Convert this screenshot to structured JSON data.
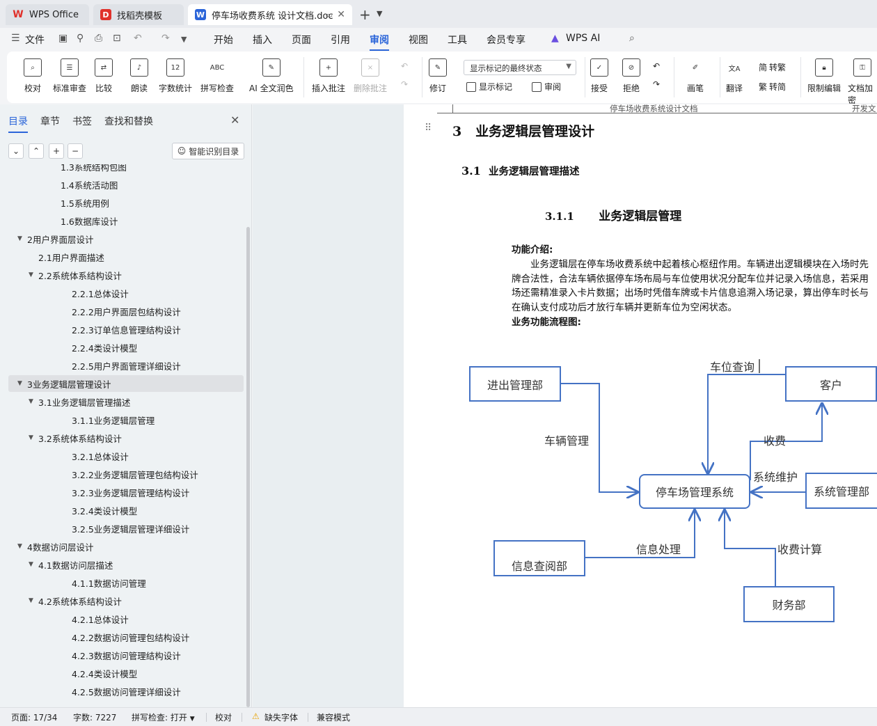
{
  "titlebar": {
    "tabs": [
      {
        "label": "WPS Office",
        "icon": "wps-logo-icon"
      },
      {
        "label": "找稻壳模板",
        "icon": "docer-icon"
      },
      {
        "label": "停车场收费系统 设计文档.doc",
        "icon": "word-doc-icon",
        "active": true
      }
    ],
    "add_tab": "+",
    "more": "⌄"
  },
  "menubar": {
    "file": "文件",
    "items": [
      "开始",
      "插入",
      "页面",
      "引用",
      "审阅",
      "视图",
      "工具",
      "会员专享",
      "WPS AI"
    ],
    "active": "审阅"
  },
  "ribbon": {
    "proofread": "校对",
    "standard_review": "标准审查",
    "compare": "比较",
    "read_aloud": "朗读",
    "word_count": "字数统计",
    "word_count_icon_text": "12",
    "spell_check": "拼写检查",
    "spell_icon_text": "ABC",
    "ai_polish": "AI 全文润色",
    "insert_comment": "插入批注",
    "delete_comment": "删除批注",
    "markup_select": "显示标记的最终状态",
    "track_changes": "修订",
    "show_markup": "显示标记",
    "review": "审阅",
    "accept": "接受",
    "reject": "拒绝",
    "pen": "画笔",
    "translate": "翻译",
    "to_traditional": "转繁",
    "to_simplified": "转简",
    "restrict_edit": "限制编辑",
    "doc_encrypt": "文档加密"
  },
  "navpane": {
    "tabs": [
      "目录",
      "章节",
      "书签",
      "查找和替换"
    ],
    "active_tab": "目录",
    "smart_toc": "智能识别目录",
    "toc": [
      {
        "label": "1.3系统结构包图",
        "level": 2,
        "arrow": ""
      },
      {
        "label": "1.4系统活动图",
        "level": 2,
        "arrow": ""
      },
      {
        "label": "1.5系统用例",
        "level": 2,
        "arrow": ""
      },
      {
        "label": "1.6数据库设计",
        "level": 2,
        "arrow": ""
      },
      {
        "label": "2用户界面层设计",
        "level": 0,
        "arrow": "▼"
      },
      {
        "label": "2.1用户界面描述",
        "level": 1,
        "arrow": ""
      },
      {
        "label": "2.2系统体系结构设计",
        "level": 1,
        "arrow": "▼"
      },
      {
        "label": "2.2.1总体设计",
        "level": 3,
        "arrow": ""
      },
      {
        "label": "2.2.2用户界面层包结构设计",
        "level": 3,
        "arrow": ""
      },
      {
        "label": "2.2.3订单信息管理结构设计",
        "level": 3,
        "arrow": ""
      },
      {
        "label": "2.2.4类设计模型",
        "level": 3,
        "arrow": ""
      },
      {
        "label": "2.2.5用户界面管理详细设计",
        "level": 3,
        "arrow": ""
      },
      {
        "label": "3业务逻辑层管理设计",
        "level": 0,
        "arrow": "▼",
        "selected": true
      },
      {
        "label": "3.1业务逻辑层管理描述",
        "level": 1,
        "arrow": "▼"
      },
      {
        "label": "3.1.1业务逻辑层管理",
        "level": 3,
        "arrow": ""
      },
      {
        "label": "3.2系统体系结构设计",
        "level": 1,
        "arrow": "▼"
      },
      {
        "label": "3.2.1总体设计",
        "level": 3,
        "arrow": ""
      },
      {
        "label": "3.2.2业务逻辑层管理包结构设计",
        "level": 3,
        "arrow": ""
      },
      {
        "label": "3.2.3业务逻辑层管理结构设计",
        "level": 3,
        "arrow": ""
      },
      {
        "label": "3.2.4类设计模型",
        "level": 3,
        "arrow": ""
      },
      {
        "label": "3.2.5业务逻辑层管理详细设计",
        "level": 3,
        "arrow": ""
      },
      {
        "label": "4数据访问层设计",
        "level": 0,
        "arrow": "▼"
      },
      {
        "label": "4.1数据访问层描述",
        "level": 1,
        "arrow": "▼"
      },
      {
        "label": "4.1.1数据访问管理",
        "level": 3,
        "arrow": ""
      },
      {
        "label": "4.2系统体系结构设计",
        "level": 1,
        "arrow": "▼"
      },
      {
        "label": "4.2.1总体设计",
        "level": 3,
        "arrow": ""
      },
      {
        "label": "4.2.2数据访问管理包结构设计",
        "level": 3,
        "arrow": ""
      },
      {
        "label": "4.2.3数据访问管理结构设计",
        "level": 3,
        "arrow": ""
      },
      {
        "label": "4.2.4类设计模型",
        "level": 3,
        "arrow": ""
      },
      {
        "label": "4.2.5数据访问管理详细设计",
        "level": 3,
        "arrow": ""
      }
    ]
  },
  "document": {
    "header_left": "停车场收费系统设计文档",
    "header_right": "开发文",
    "h1_num": "3",
    "h1_text": "业务逻辑层管理设计",
    "h2_num": "3.1",
    "h2_text": "业务逻辑层管理描述",
    "h3_num": "3.1.1",
    "h3_text": "业务逻辑层管理",
    "func_intro_label": "功能介绍:",
    "para_lines": [
      "业务逻辑层在停车场收费系统中起着核心枢纽作用。车辆进出逻辑模块在入场时先",
      "牌合法性，合法车辆依据停车场布局与车位使用状况分配车位并记录入场信息，若采用",
      "场还需精准录入卡片数据；出场时凭借车牌或卡片信息追溯入场记录，算出停车时长与",
      "在确认支付成功后才放行车辆并更新车位为空闲状态。"
    ],
    "flow_label": "业务功能流程图:",
    "flow": {
      "box_inout": "进出管理部",
      "box_customer": "客户",
      "box_system": "停车场管理系统",
      "box_sysadmin": "系统管理部",
      "box_info": "信息查阅部",
      "box_finance": "财务部",
      "lbl_space_query": "车位查询",
      "lbl_vehicle_mgmt": "车辆管理",
      "lbl_charge": "收费",
      "lbl_maintain": "系统维护",
      "lbl_info_proc": "信息处理",
      "lbl_fee_calc": "收费计算",
      "line_color": "#4472c4"
    }
  },
  "statusbar": {
    "page": "页面: 17/34",
    "word_count": "字数: 7227",
    "spell_check": "拼写检查: 打开",
    "proofread": "校对",
    "missing_font": "缺失字体",
    "compat_mode": "兼容模式"
  },
  "colors": {
    "accent": "#2b65d9",
    "wps_red": "#e0312b",
    "warning": "#e8a200"
  }
}
